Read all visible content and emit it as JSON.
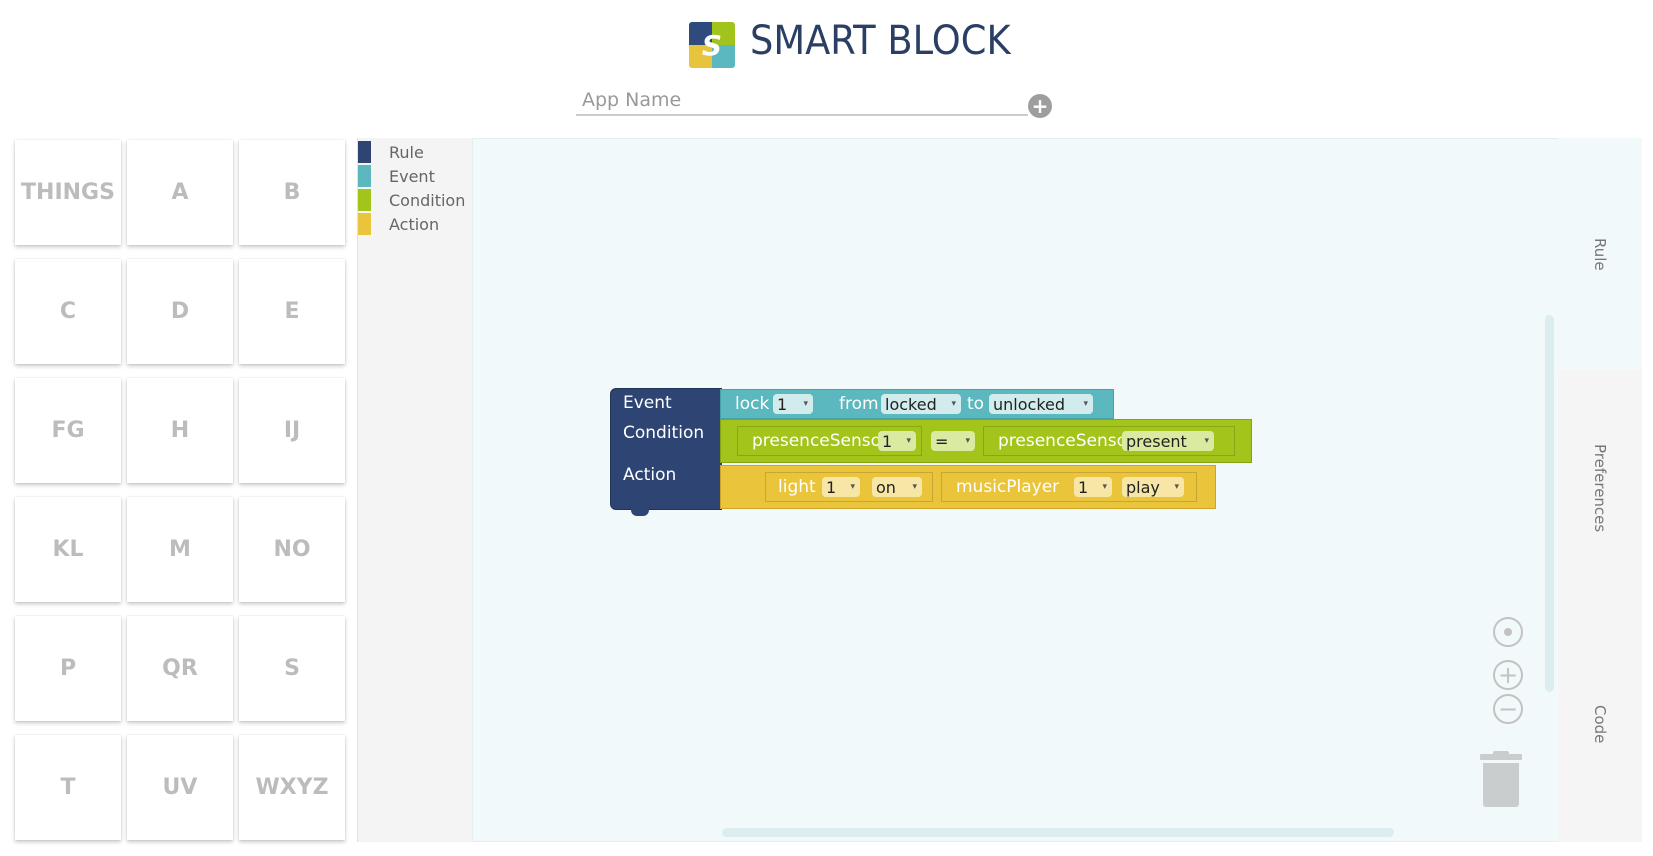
{
  "header": {
    "title": "SMART BLOCK",
    "logo_letter": "S",
    "app_name_placeholder": "App Name",
    "add_symbol": "+"
  },
  "things": {
    "tiles": [
      "THINGS",
      "A",
      "B",
      "C",
      "D",
      "E",
      "FG",
      "H",
      "IJ",
      "KL",
      "M",
      "NO",
      "P",
      "QR",
      "S",
      "T",
      "UV",
      "WXYZ"
    ]
  },
  "toolbox": {
    "categories": [
      {
        "label": "Rule",
        "color": "#2e4573"
      },
      {
        "label": "Event",
        "color": "#5bb8be"
      },
      {
        "label": "Condition",
        "color": "#a3c41a"
      },
      {
        "label": "Action",
        "color": "#eac53b"
      }
    ]
  },
  "side_tabs": {
    "rule": "Rule",
    "preferences": "Preferences",
    "code": "Code"
  },
  "blocks": {
    "rule": {
      "event_label": "Event",
      "condition_label": "Condition",
      "action_label": "Action"
    },
    "event": {
      "device": "lock",
      "device_index": "1",
      "from_label": "from",
      "from_value": "locked",
      "to_label": "to",
      "to_value": "unlocked"
    },
    "condition": {
      "left_device": "presenceSensor",
      "left_index": "1",
      "operator": "=",
      "right_device": "presenceSensor",
      "right_value": "present"
    },
    "action": {
      "first_device": "light",
      "first_index": "1",
      "first_command": "on",
      "second_device": "musicPlayer",
      "second_index": "1",
      "second_command": "play"
    }
  },
  "colors": {
    "rule": "#2e4573",
    "event": "#5bb8be",
    "condition": "#a3c41a",
    "action": "#eac53b",
    "workspace": "#f1f9fa"
  },
  "icons": {
    "dropdown": "▾",
    "gear": "⚙"
  }
}
